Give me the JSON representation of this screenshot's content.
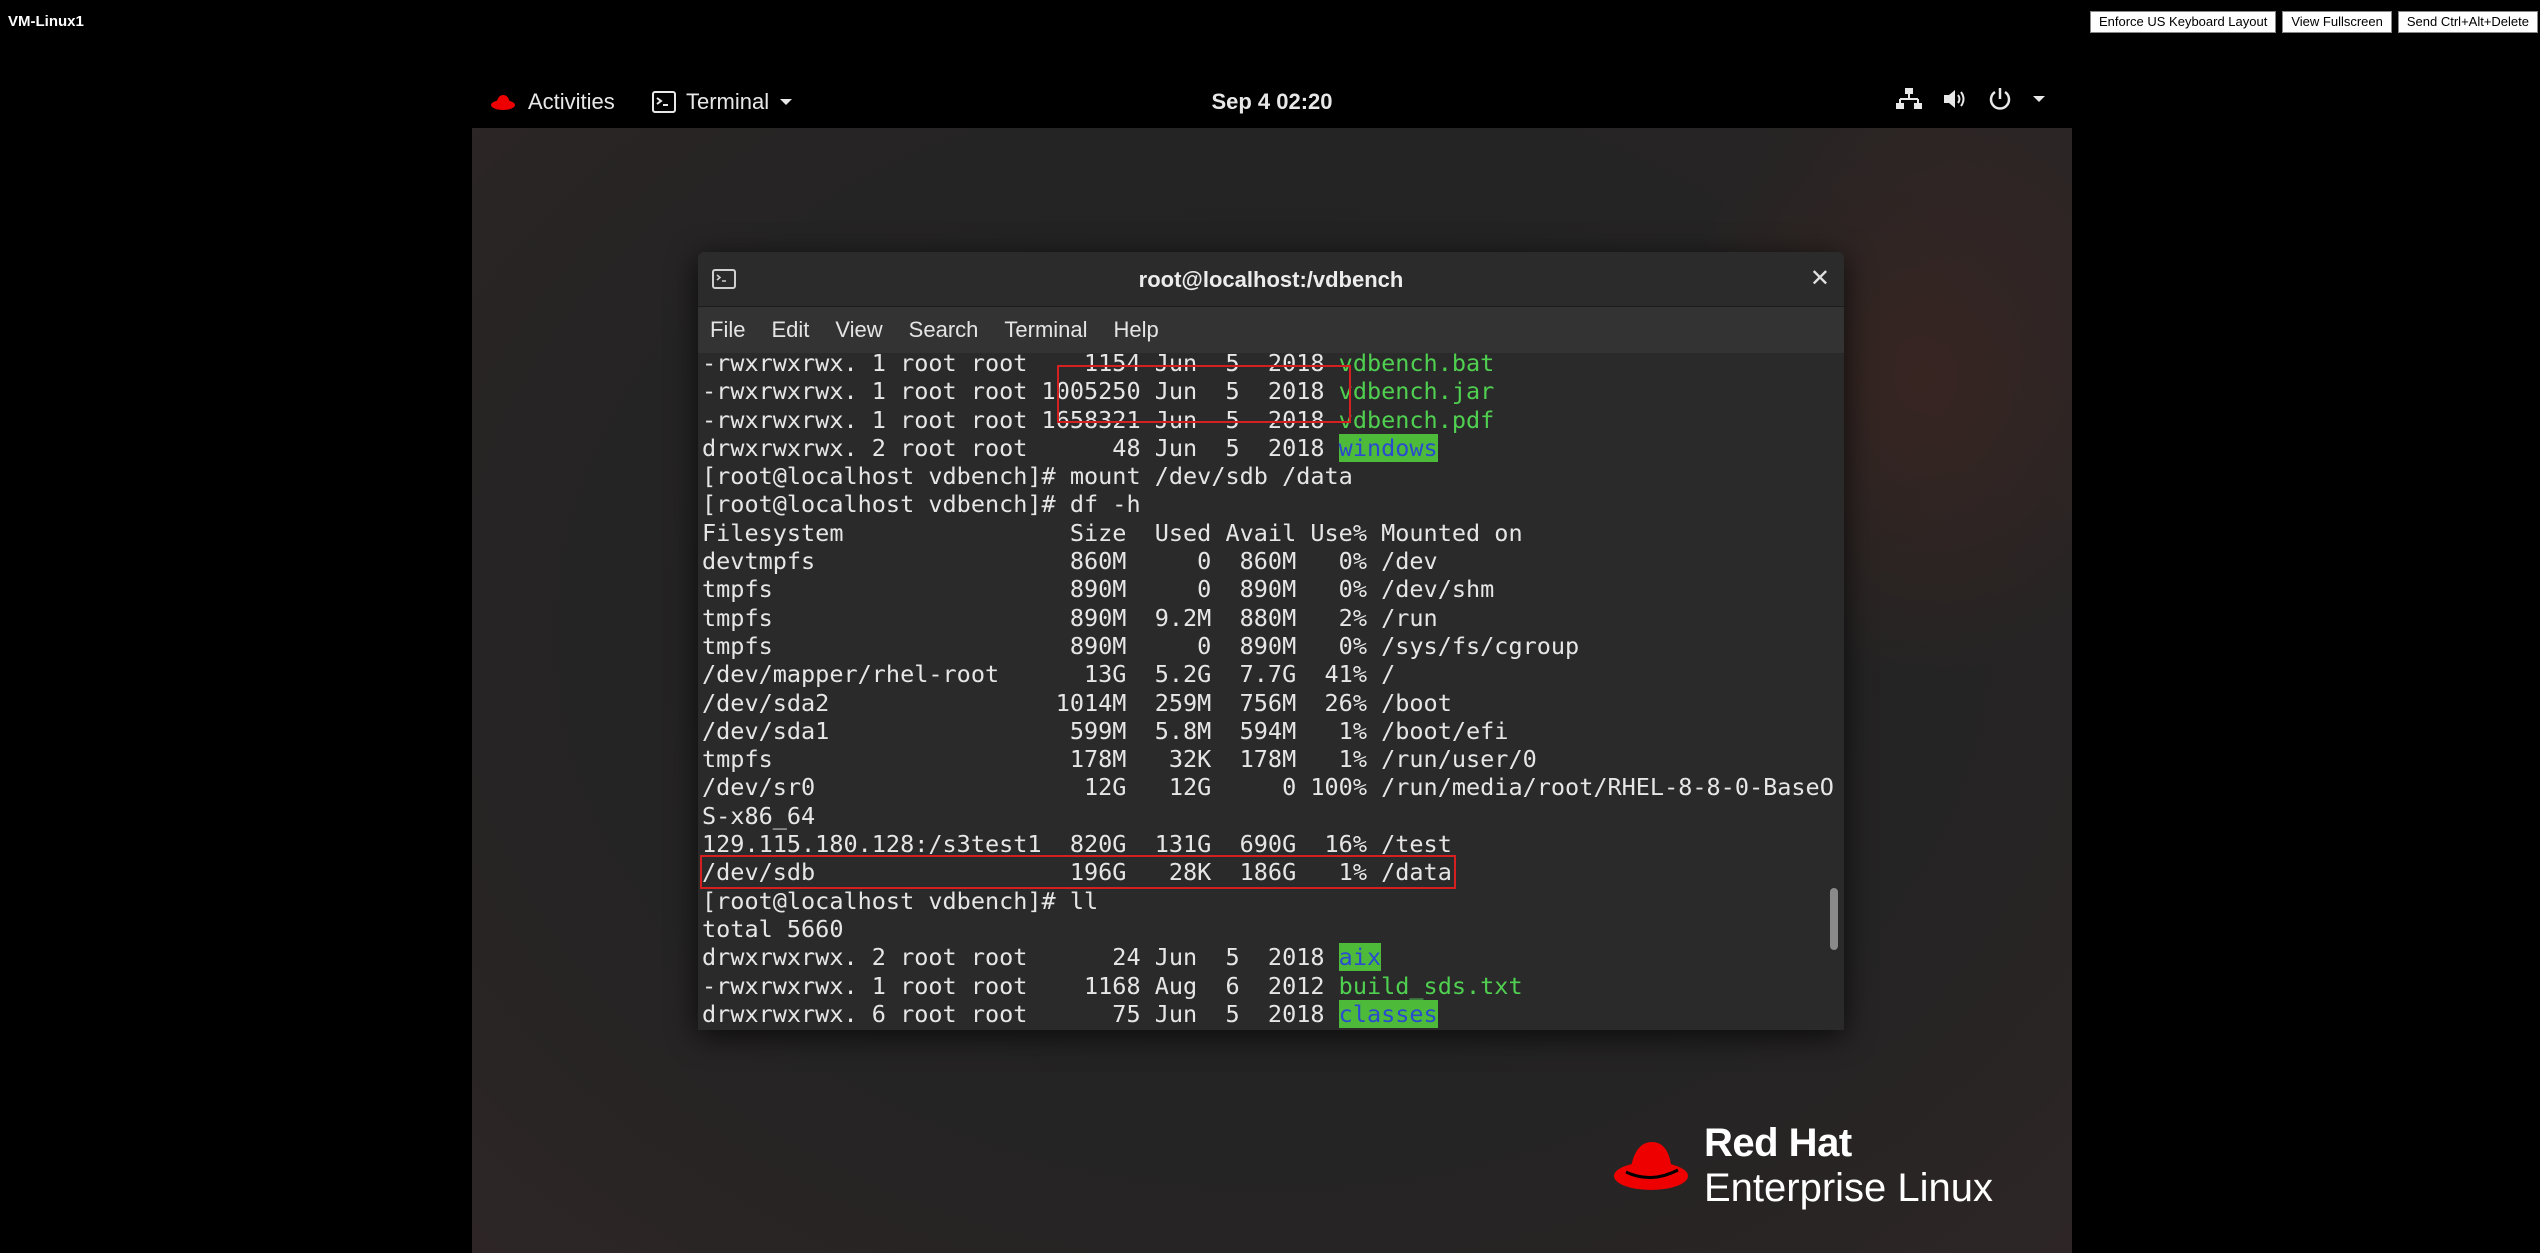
{
  "vm": {
    "title": "VM-Linux1",
    "buttons": [
      "Enforce US Keyboard Layout",
      "View Fullscreen",
      "Send Ctrl+Alt+Delete"
    ]
  },
  "topbar": {
    "activities": "Activities",
    "app": "Terminal",
    "clock": "Sep 4  02:20"
  },
  "terminal": {
    "title": "root@localhost:/vdbench",
    "menu": [
      "File",
      "Edit",
      "View",
      "Search",
      "Terminal",
      "Help"
    ],
    "lines": [
      {
        "pre": "-rwxrwxrwx. 1 root root    1154 Jun  5  2018 ",
        "name": "vdbench.bat",
        "style": "g"
      },
      {
        "pre": "-rwxrwxrwx. 1 root root 1005250 Jun  5  2018 ",
        "name": "vdbench.jar",
        "style": "g"
      },
      {
        "pre": "-rwxrwxrwx. 1 root root 1658321 Jun  5  2018 ",
        "name": "vdbench.pdf",
        "style": "g"
      },
      {
        "pre": "drwxrwxrwx. 2 root root      48 Jun  5  2018 ",
        "name": "windows",
        "style": "hl"
      },
      {
        "pre": "[root@localhost vdbench]# mount /dev/sdb /data",
        "name": "",
        "style": ""
      },
      {
        "pre": "[root@localhost vdbench]# df -h",
        "name": "",
        "style": ""
      },
      {
        "pre": "Filesystem                Size  Used Avail Use% Mounted on",
        "name": "",
        "style": ""
      },
      {
        "pre": "devtmpfs                  860M     0  860M   0% /dev",
        "name": "",
        "style": ""
      },
      {
        "pre": "tmpfs                     890M     0  890M   0% /dev/shm",
        "name": "",
        "style": ""
      },
      {
        "pre": "tmpfs                     890M  9.2M  880M   2% /run",
        "name": "",
        "style": ""
      },
      {
        "pre": "tmpfs                     890M     0  890M   0% /sys/fs/cgroup",
        "name": "",
        "style": ""
      },
      {
        "pre": "/dev/mapper/rhel-root      13G  5.2G  7.7G  41% /",
        "name": "",
        "style": ""
      },
      {
        "pre": "/dev/sda2                1014M  259M  756M  26% /boot",
        "name": "",
        "style": ""
      },
      {
        "pre": "/dev/sda1                 599M  5.8M  594M   1% /boot/efi",
        "name": "",
        "style": ""
      },
      {
        "pre": "tmpfs                     178M   32K  178M   1% /run/user/0",
        "name": "",
        "style": ""
      },
      {
        "pre": "/dev/sr0                   12G   12G     0 100% /run/media/root/RHEL-8-8-0-BaseO",
        "name": "",
        "style": ""
      },
      {
        "pre": "S-x86_64",
        "name": "",
        "style": ""
      },
      {
        "pre": "129.115.180.128:/s3test1  820G  131G  690G  16% /test",
        "name": "",
        "style": ""
      },
      {
        "pre": "/dev/sdb                  196G   28K  186G   1% /data",
        "name": "",
        "style": ""
      },
      {
        "pre": "[root@localhost vdbench]# ll",
        "name": "",
        "style": ""
      },
      {
        "pre": "total 5660",
        "name": "",
        "style": ""
      },
      {
        "pre": "drwxrwxrwx. 2 root root      24 Jun  5  2018 ",
        "name": "aix",
        "style": "hl"
      },
      {
        "pre": "-rwxrwxrwx. 1 root root    1168 Aug  6  2012 ",
        "name": "build_sds.txt",
        "style": "g"
      },
      {
        "pre": "drwxrwxrwx. 6 root root      75 Jun  5  2018 ",
        "name": "classes",
        "style": "hl"
      }
    ]
  },
  "logo": {
    "line1": "Red Hat",
    "line2": "Enterprise Linux"
  },
  "colors": {
    "brand_red": "#ee0000",
    "ls_green": "#50d050",
    "dir_bg": "#4dbb39",
    "dir_fg": "#2a4bd0",
    "highlight_box": "#d42020"
  },
  "icons": [
    "redhat-hat-icon",
    "terminal-icon",
    "chevron-down-icon",
    "network-icon",
    "volume-icon",
    "power-icon",
    "close-icon"
  ]
}
